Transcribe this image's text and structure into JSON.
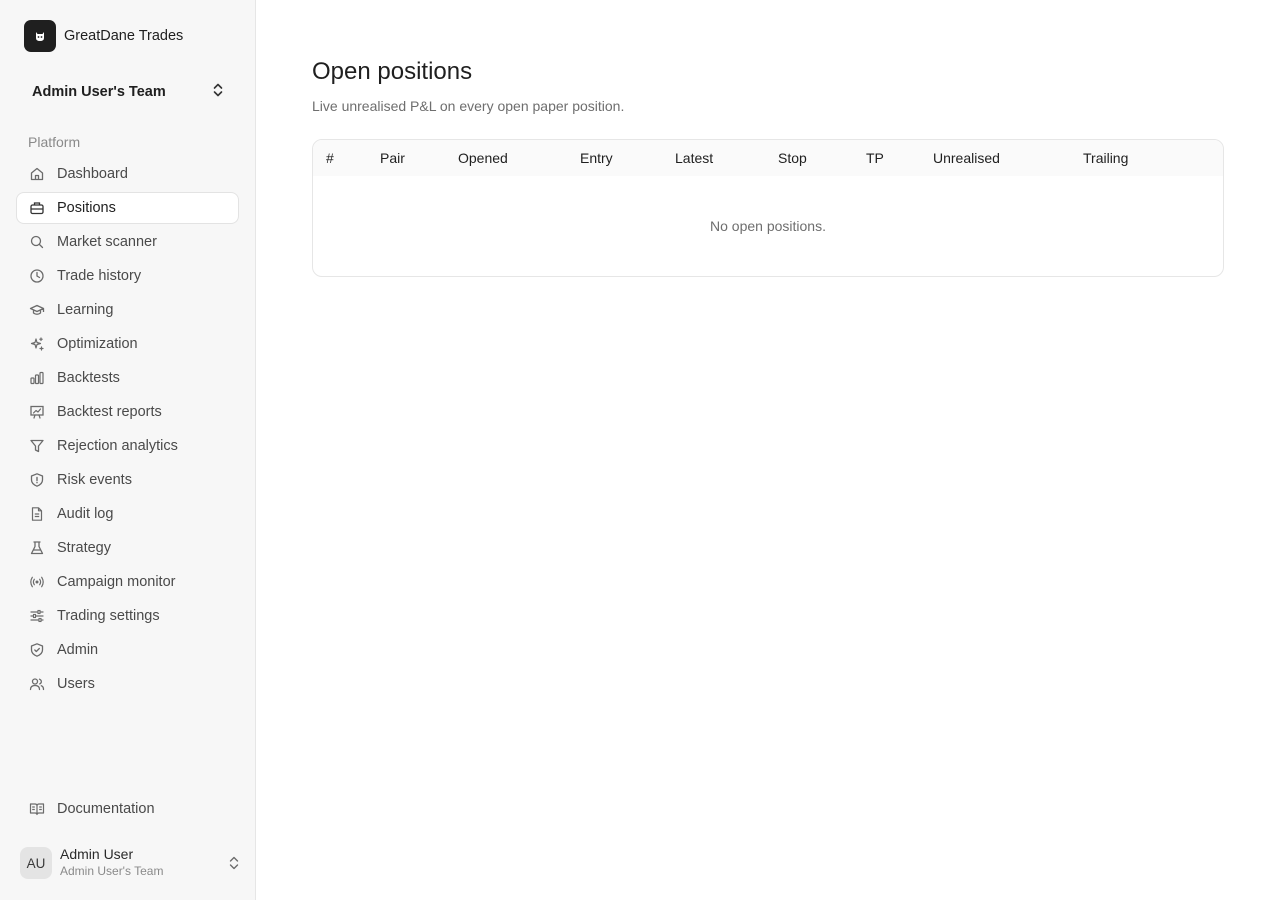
{
  "brand": {
    "name": "GreatDane Trades",
    "icon": "dog-logo-icon"
  },
  "team": {
    "name": "Admin User's Team",
    "icon": "chevrons-up-down-icon"
  },
  "sidebar": {
    "section_label": "Platform",
    "items": [
      {
        "label": "Dashboard",
        "icon": "home-icon",
        "active": false
      },
      {
        "label": "Positions",
        "icon": "briefcase-icon",
        "active": true
      },
      {
        "label": "Market scanner",
        "icon": "search-icon",
        "active": false
      },
      {
        "label": "Trade history",
        "icon": "clock-icon",
        "active": false
      },
      {
        "label": "Learning",
        "icon": "graduation-cap-icon",
        "active": false
      },
      {
        "label": "Optimization",
        "icon": "sparkles-icon",
        "active": false
      },
      {
        "label": "Backtests",
        "icon": "bar-chart-icon",
        "active": false
      },
      {
        "label": "Backtest reports",
        "icon": "presentation-chart-icon",
        "active": false
      },
      {
        "label": "Rejection analytics",
        "icon": "filter-icon",
        "active": false
      },
      {
        "label": "Risk events",
        "icon": "shield-alert-icon",
        "active": false
      },
      {
        "label": "Audit log",
        "icon": "file-text-icon",
        "active": false
      },
      {
        "label": "Strategy",
        "icon": "flask-icon",
        "active": false
      },
      {
        "label": "Campaign monitor",
        "icon": "radio-icon",
        "active": false
      },
      {
        "label": "Trading settings",
        "icon": "sliders-icon",
        "active": false
      },
      {
        "label": "Admin",
        "icon": "shield-check-icon",
        "active": false
      },
      {
        "label": "Users",
        "icon": "users-icon",
        "active": false
      }
    ],
    "docs": {
      "label": "Documentation",
      "icon": "book-open-icon"
    }
  },
  "user": {
    "initials": "AU",
    "name": "Admin User",
    "team": "Admin User's Team",
    "icon": "chevrons-up-down-icon"
  },
  "main": {
    "title": "Open positions",
    "subtitle": "Live unrealised P&L on every open paper position.",
    "table": {
      "columns": [
        "#",
        "Pair",
        "Opened",
        "Entry",
        "Latest",
        "Stop",
        "TP",
        "Unrealised",
        "Trailing"
      ],
      "rows": [],
      "empty_text": "No open positions."
    }
  }
}
